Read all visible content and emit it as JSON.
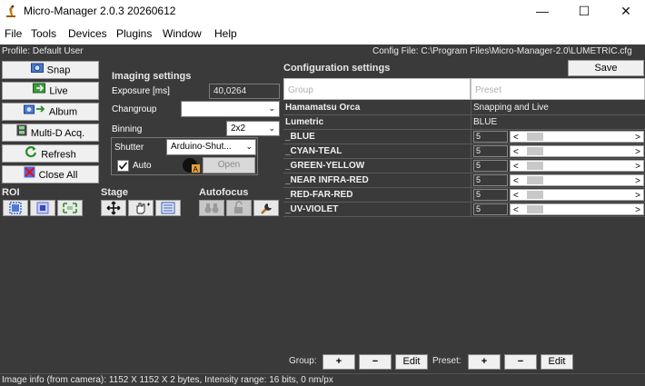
{
  "window": {
    "title": "Micro-Manager 2.0.3 20260612",
    "min_glyph": "—",
    "max_glyph": "☐",
    "close_glyph": "✕"
  },
  "menu": [
    "File",
    "Tools",
    "Devices",
    "Plugins",
    "Window",
    "Help"
  ],
  "header": {
    "profile": "Profile: Default User",
    "config_file": "Config File: C:\\Program Files\\Micro-Manager-2.0\\LUMETRIC.cfg"
  },
  "buttons": {
    "snap": "Snap",
    "live": "Live",
    "album": "Album",
    "mda": "Multi-D Acq.",
    "refresh": "Refresh",
    "close_all": "Close All"
  },
  "imaging": {
    "title": "Imaging settings",
    "exposure_label": "Exposure [ms]",
    "exposure_value": "40,0264",
    "changroup_label": "Changroup",
    "changroup_value": "",
    "binning_label": "Binning",
    "binning_value": "2x2",
    "shutter_label": "Shutter",
    "shutter_value": "Arduino-Shut...",
    "auto_label": "Auto",
    "auto_checked": true,
    "open_label": "Open"
  },
  "sections": {
    "roi": "ROI",
    "stage": "Stage",
    "autofocus": "Autofocus"
  },
  "config": {
    "title": "Configuration settings",
    "save": "Save",
    "group_placeholder": "Group",
    "preset_placeholder": "Preset",
    "rows": [
      {
        "group": "Hamamatsu Orca",
        "preset": "Snapping and Live",
        "slider": false
      },
      {
        "group": "Lumetric",
        "preset": "BLUE",
        "slider": false
      },
      {
        "group": "_BLUE",
        "preset": "5",
        "slider": true
      },
      {
        "group": "_CYAN-TEAL",
        "preset": "5",
        "slider": true
      },
      {
        "group": "_GREEN-YELLOW",
        "preset": "5",
        "slider": true
      },
      {
        "group": "_NEAR INFRA-RED",
        "preset": "5",
        "slider": true
      },
      {
        "group": "_RED-FAR-RED",
        "preset": "5",
        "slider": true
      },
      {
        "group": "_UV-VIOLET",
        "preset": "5",
        "slider": true
      }
    ],
    "group_label": "Group:",
    "preset_label": "Preset:",
    "plus": "+",
    "minus": "−",
    "edit": "Edit"
  },
  "status": "Image info (from camera): 1152 X 1152 X 2 bytes, Intensity range: 16 bits, 0 nm/px"
}
